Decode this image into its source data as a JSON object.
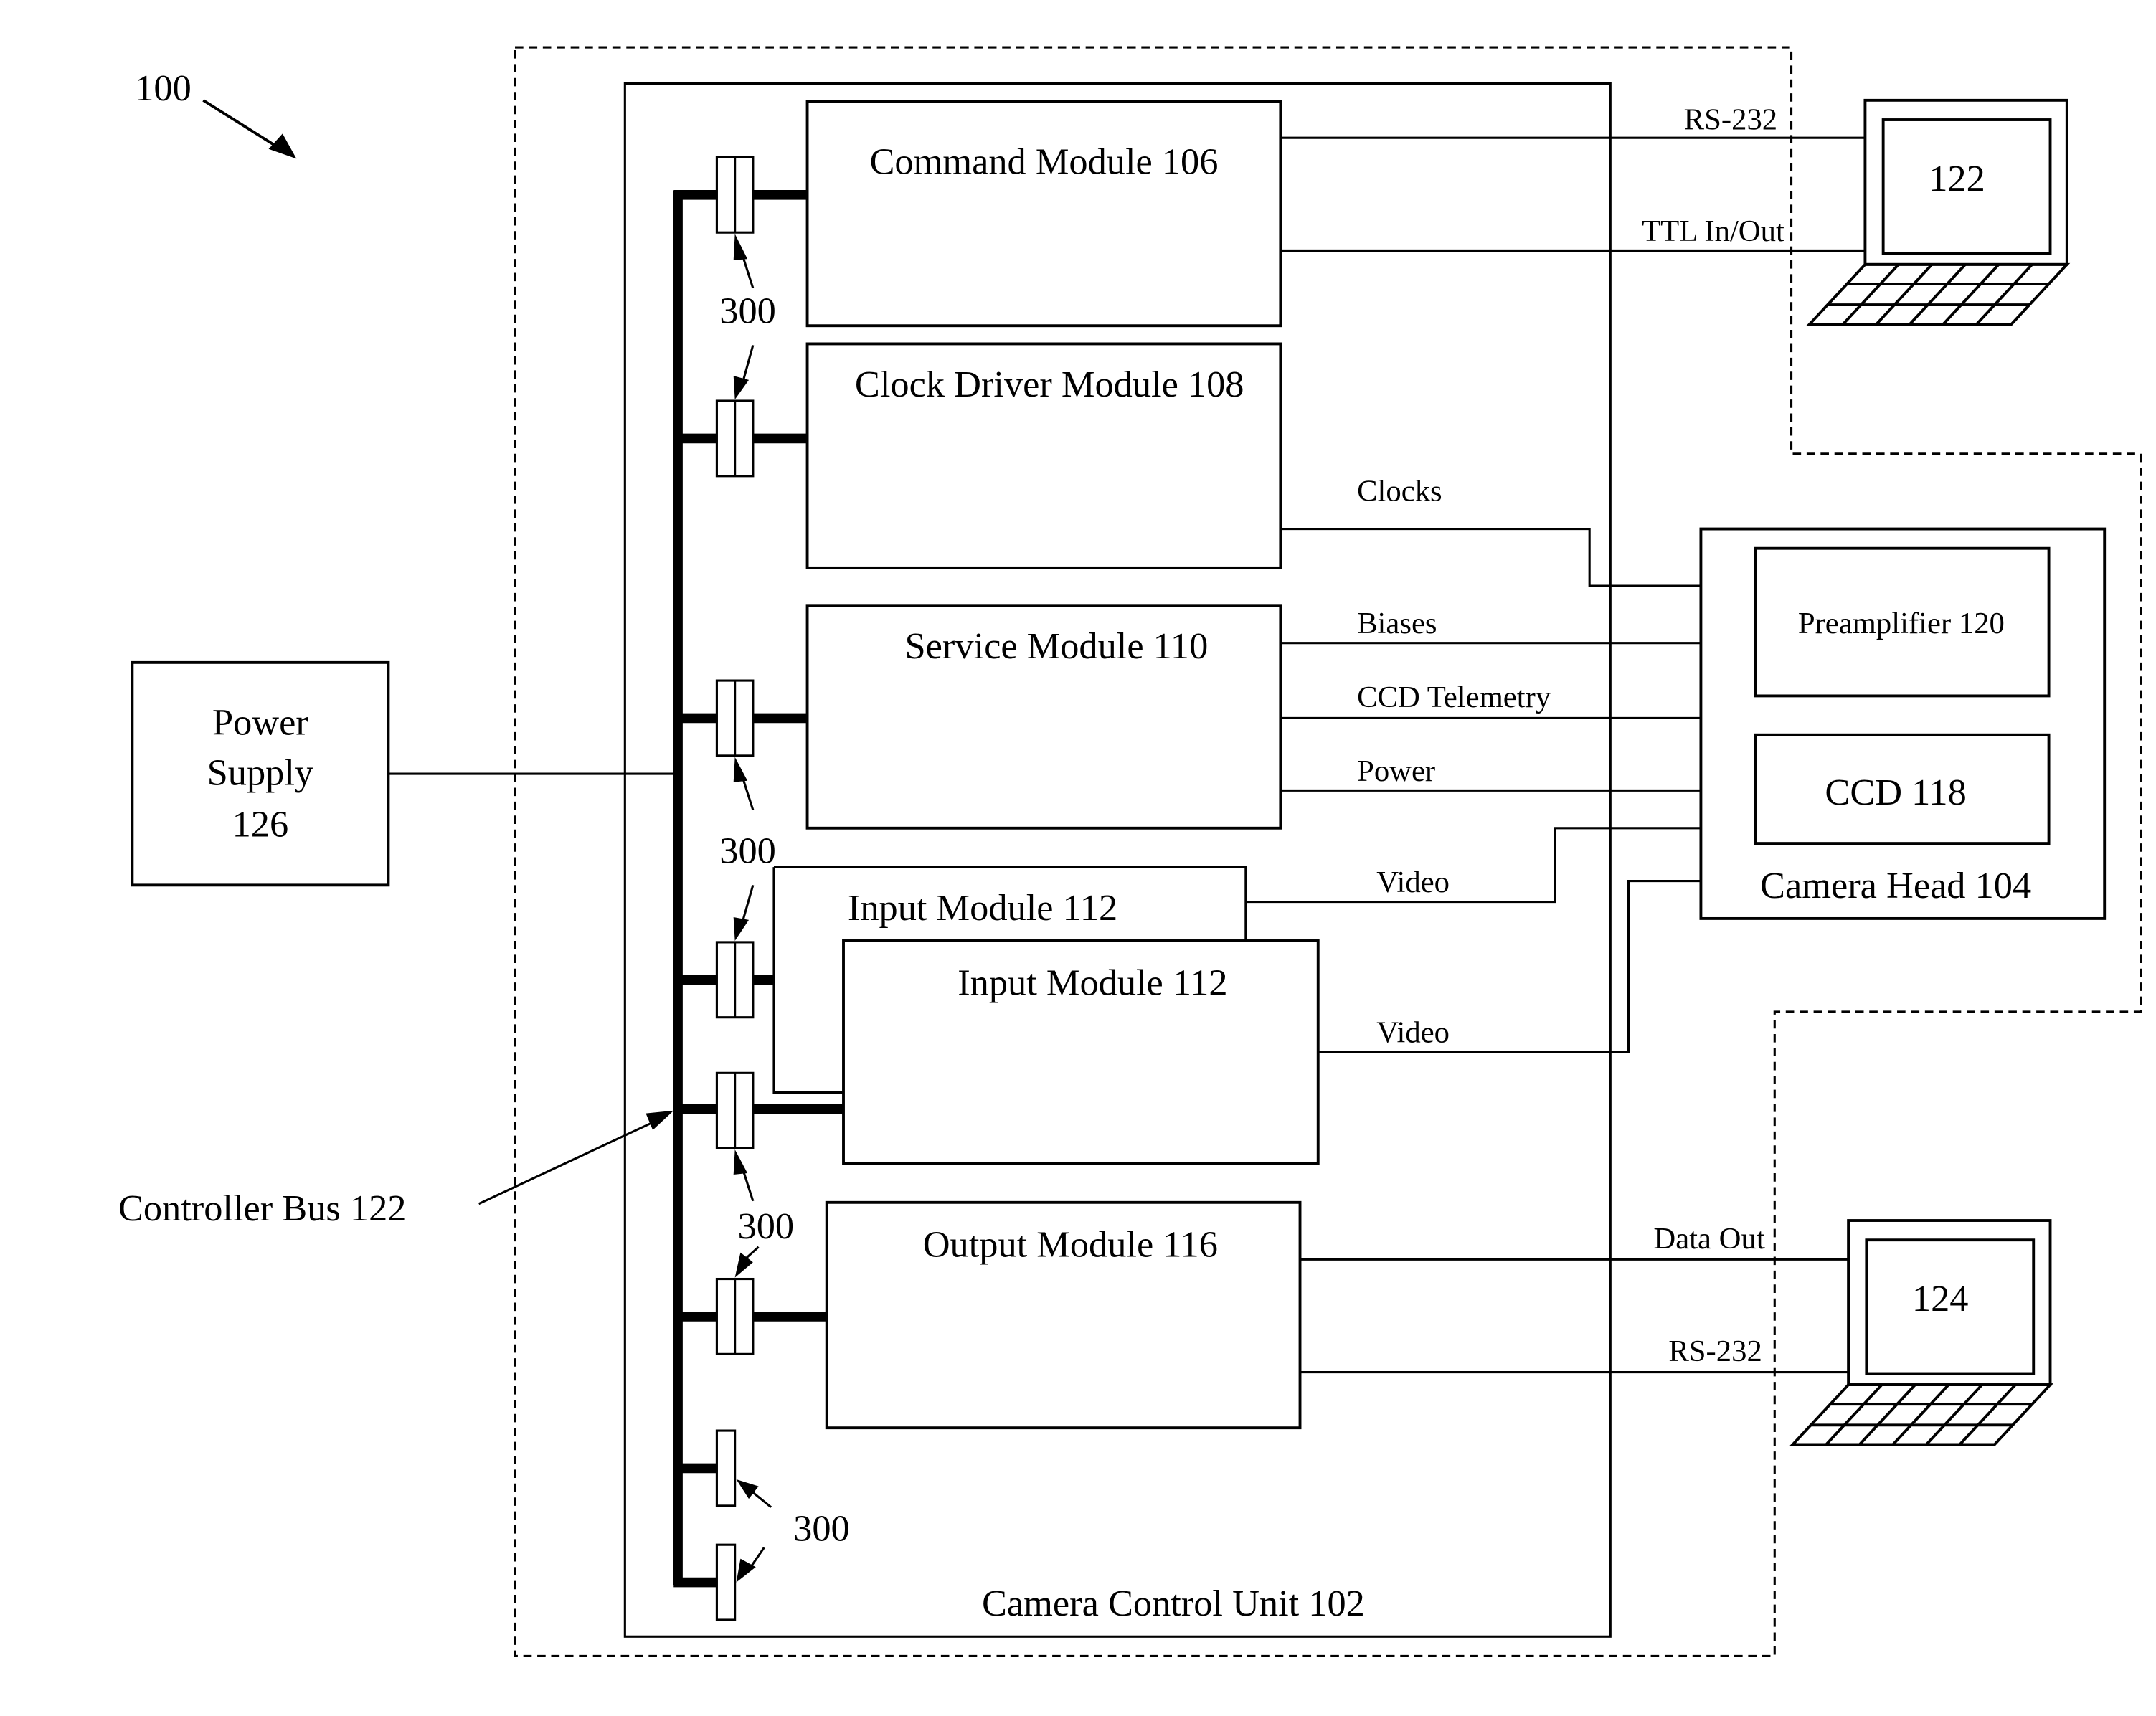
{
  "figure": {
    "reference": "100",
    "camera_control_unit": {
      "label": "Camera Control Unit 102"
    },
    "modules": [
      {
        "id": "command",
        "label": "Command Module 106"
      },
      {
        "id": "clock-driver",
        "label": "Clock Driver Module 108"
      },
      {
        "id": "service",
        "label": "Service Module 110"
      },
      {
        "id": "input-a",
        "label": "Input Module 112"
      },
      {
        "id": "input-b",
        "label": "Input Module 112"
      },
      {
        "id": "output",
        "label": "Output Module 116"
      }
    ],
    "connector_ref": "300",
    "controller_bus": {
      "label": "Controller Bus 122"
    },
    "power_supply": {
      "line1": "Power",
      "line2": "Supply",
      "line3": "126"
    },
    "camera_head": {
      "label": "Camera Head 104",
      "preamplifier": "Preamplifier 120",
      "ccd": "CCD 118"
    },
    "computers": [
      {
        "id": "top",
        "label": "122"
      },
      {
        "id": "bottom",
        "label": "124"
      }
    ],
    "signals": {
      "rs232_top": "RS-232",
      "ttl": "TTL In/Out",
      "clocks": "Clocks",
      "biases": "Biases",
      "ccd_telemetry": "CCD Telemetry",
      "power": "Power",
      "video_a": "Video",
      "video_b": "Video",
      "data_out": "Data Out",
      "rs232_bottom": "RS-232"
    }
  }
}
